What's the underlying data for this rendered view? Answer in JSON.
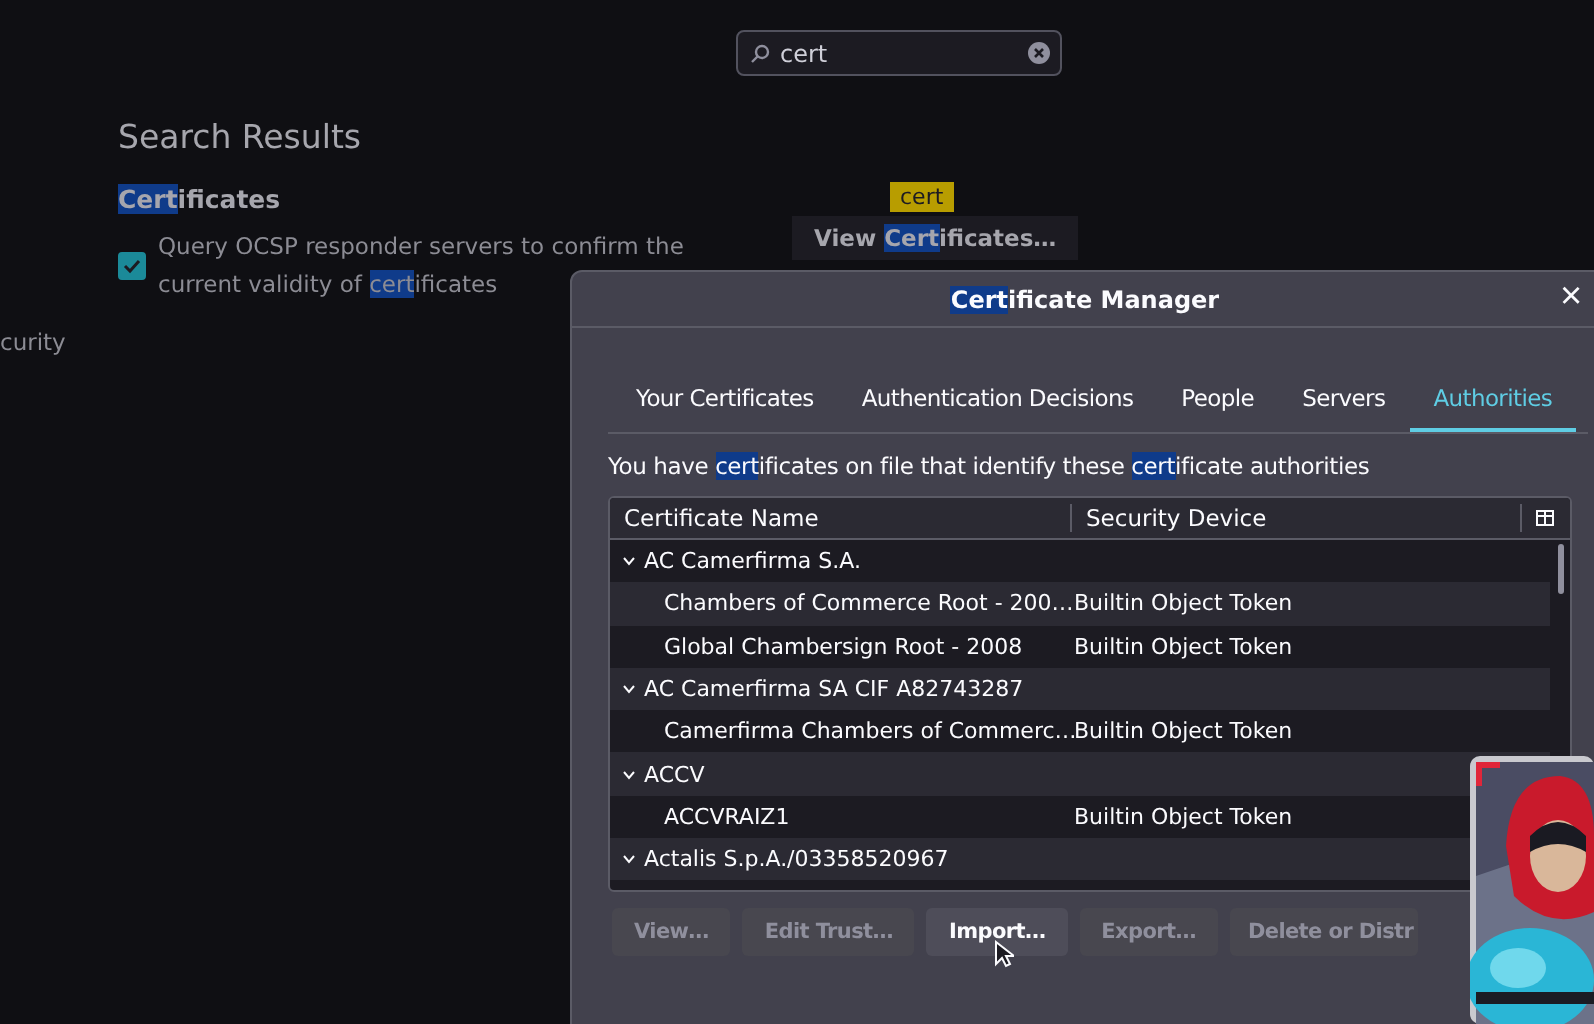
{
  "search": {
    "value": "cert"
  },
  "page": {
    "title": "Search Results",
    "section": [
      {
        "text": "Cert",
        "highlight": true
      },
      {
        "text": "ificates",
        "highlight": false
      }
    ],
    "option": {
      "checked": true,
      "label": [
        {
          "text": "Query OCSP responder servers to confirm the current validity of ",
          "highlight": false
        },
        {
          "text": "cert",
          "highlight": true
        },
        {
          "text": "ificates",
          "highlight": false
        }
      ]
    },
    "tooltip": "cert",
    "view_button": [
      {
        "text": "View ",
        "highlight": false
      },
      {
        "text": "Cert",
        "highlight": true
      },
      {
        "text": "ificates…",
        "highlight": false
      }
    ],
    "sidebar_fragment": "curity"
  },
  "dialog": {
    "title": [
      {
        "text": "Cert",
        "highlight": true
      },
      {
        "text": "ificate Manager",
        "highlight": false
      }
    ],
    "close": "×",
    "tabs": [
      {
        "label": "Your Certificates",
        "selected": false
      },
      {
        "label": "Authentication Decisions",
        "selected": false
      },
      {
        "label": "People",
        "selected": false
      },
      {
        "label": "Servers",
        "selected": false
      },
      {
        "label": "Authorities",
        "selected": true
      }
    ],
    "description": [
      {
        "text": "You have ",
        "highlight": false
      },
      {
        "text": "cert",
        "highlight": true
      },
      {
        "text": "ificates on file that identify these ",
        "highlight": false
      },
      {
        "text": "cert",
        "highlight": true
      },
      {
        "text": "ificate authorities",
        "highlight": false
      }
    ],
    "table": {
      "columns": [
        "Certificate Name",
        "Security Device"
      ],
      "groups": [
        {
          "name": "AC Camerfirma S.A.",
          "expanded": true,
          "children": [
            {
              "name": "Chambers of Commerce Root - 200…",
              "device": "Builtin Object Token"
            },
            {
              "name": "Global Chambersign Root - 2008",
              "device": "Builtin Object Token"
            }
          ]
        },
        {
          "name": "AC Camerfirma SA CIF A82743287",
          "expanded": true,
          "children": [
            {
              "name": "Camerfirma Chambers of Commerc…",
              "device": "Builtin Object Token"
            }
          ]
        },
        {
          "name": "ACCV",
          "expanded": true,
          "children": [
            {
              "name": "ACCVRAIZ1",
              "device": "Builtin Object Token"
            }
          ]
        },
        {
          "name": "Actalis S.p.A./03358520967",
          "expanded": true
        }
      ]
    },
    "buttons": [
      {
        "label": "View…",
        "disabled": true
      },
      {
        "label": "Edit Trust…",
        "disabled": true
      },
      {
        "label": "Import…",
        "disabled": false
      },
      {
        "label": "Export…",
        "disabled": true
      },
      {
        "label": "Delete or Distr",
        "disabled": true
      }
    ]
  }
}
